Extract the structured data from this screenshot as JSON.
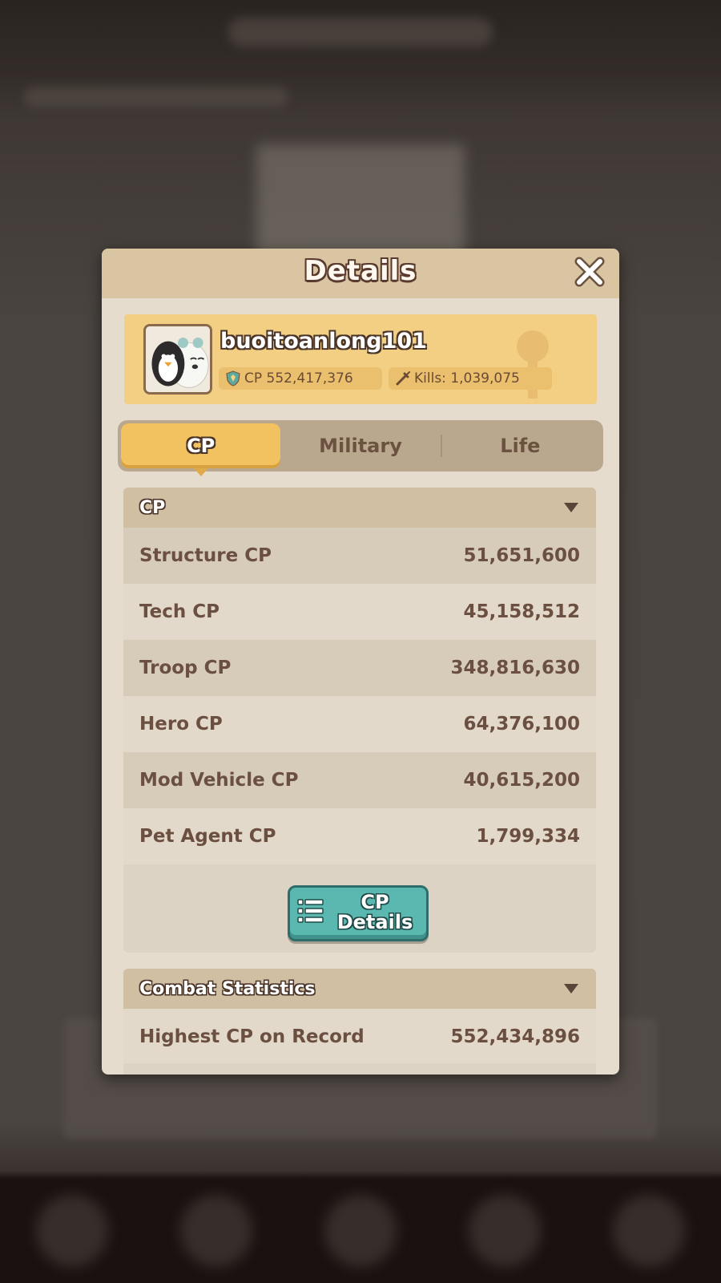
{
  "background": {
    "blurred": true
  },
  "modal": {
    "title": "Details",
    "close_icon": "close-icon"
  },
  "profile": {
    "name": "buoitoanlong101",
    "cp_label": "CP",
    "cp_value": "552,417,376",
    "kills_label": "Kills:",
    "kills_value": "1,039,075",
    "cp_icon": "shield-icon",
    "kills_icon": "sword-icon"
  },
  "tabs": [
    {
      "label": "CP",
      "active": true
    },
    {
      "label": "Military",
      "active": false
    },
    {
      "label": "Life",
      "active": false
    }
  ],
  "cp_section": {
    "title": "CP",
    "rows": [
      {
        "label": "Structure CP",
        "value": "51,651,600"
      },
      {
        "label": "Tech CP",
        "value": "45,158,512"
      },
      {
        "label": "Troop CP",
        "value": "348,816,630"
      },
      {
        "label": "Hero CP",
        "value": "64,376,100"
      },
      {
        "label": "Mod Vehicle CP",
        "value": "40,615,200"
      },
      {
        "label": "Pet Agent CP",
        "value": "1,799,334"
      }
    ],
    "details_button": "CP\nDetails"
  },
  "combat_section": {
    "title": "Combat Statistics",
    "rows": [
      {
        "label": "Highest CP on Record",
        "value": "552,434,896"
      }
    ]
  },
  "colors": {
    "header": "#d9c5a2",
    "banner": "#f3cf84",
    "tab_active": "#f2c160",
    "button_teal": "#5ab8b0"
  }
}
